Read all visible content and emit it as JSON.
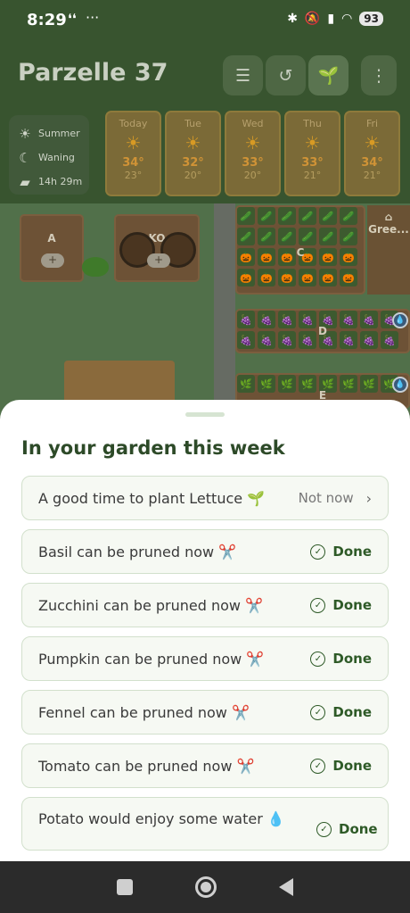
{
  "status": {
    "time": "8:29",
    "battery": "93"
  },
  "header": {
    "title": "Parzelle 37"
  },
  "season": {
    "season": "Summer",
    "moon": "Waning",
    "daylight": "14h 29m"
  },
  "forecast": [
    {
      "day": "Today",
      "hi": "34°",
      "lo": "23°"
    },
    {
      "day": "Tue",
      "hi": "32°",
      "lo": "20°"
    },
    {
      "day": "Wed",
      "hi": "33°",
      "lo": "20°"
    },
    {
      "day": "Thu",
      "hi": "33°",
      "lo": "21°"
    },
    {
      "day": "Fri",
      "hi": "34°",
      "lo": "21°"
    }
  ],
  "garden": {
    "bed_a": "A",
    "bed_k": "KO",
    "bed_c": "C",
    "bed_d": "D",
    "bed_e": "E",
    "greenhouse": "Gree..."
  },
  "sheet": {
    "title": "In your garden this week",
    "tasks": [
      {
        "text": "A good time to plant Lettuce 🌱",
        "action": "Not now"
      },
      {
        "text": "Basil can be pruned now ✂️",
        "action": "Done"
      },
      {
        "text": "Zucchini can be pruned now ✂️",
        "action": "Done"
      },
      {
        "text": "Pumpkin can be pruned now ✂️",
        "action": "Done"
      },
      {
        "text": "Fennel can be pruned now ✂️",
        "action": "Done"
      },
      {
        "text": "Tomato can be pruned now ✂️",
        "action": "Done"
      },
      {
        "text": "Potato would enjoy some water 💧",
        "action": "Done"
      }
    ]
  }
}
